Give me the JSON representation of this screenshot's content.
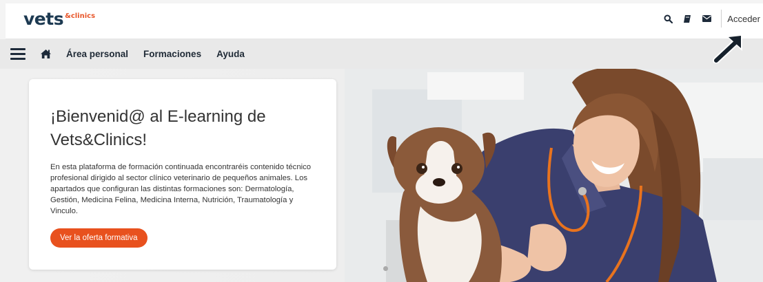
{
  "header": {
    "logo_main": "vets",
    "logo_sub": "&clinics",
    "icons": [
      "search-icon",
      "book-icon",
      "envelope-icon"
    ],
    "login_label": "Acceder"
  },
  "nav": {
    "icons": [
      "menu-icon",
      "home-icon"
    ],
    "links": [
      "Área personal",
      "Formaciones",
      "Ayuda"
    ]
  },
  "hero": {
    "title": "¡Bienvenid@ al E-learning de Vets&Clinics!",
    "body": "En esta plataforma de formación continuada encontraréis contenido técnico profesional dirigido al sector clínico veterinario de pequeños animales. Los apartados que configuran las distintas formaciones son: Dermatología, Gestión, Medicina Felina, Medicina Interna, Nutrición, Traumatología y Vinculo.",
    "cta_label": "Ver la oferta formativa"
  },
  "colors": {
    "brand_navy": "#1d3a52",
    "brand_orange": "#e8511e"
  }
}
